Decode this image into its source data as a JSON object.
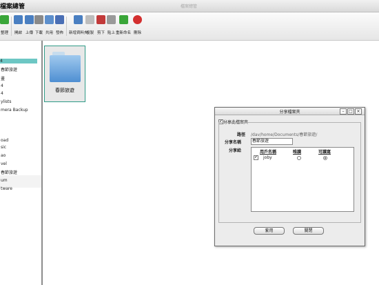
{
  "window": {
    "title": "檔案總管",
    "ghost_title": "檔案總管"
  },
  "toolbar": {
    "buttons": [
      {
        "label": "整理",
        "icon": "refresh-icon",
        "color": "#3aa639"
      },
      {
        "label": "開啟",
        "icon": "open-folder-icon",
        "color": "#4a7fc1"
      },
      {
        "label": "上傳",
        "icon": "upload-icon",
        "color": "#4a7fc1"
      },
      {
        "label": "下載",
        "icon": "download-icon",
        "color": "#8a8a8a"
      },
      {
        "label": "共用",
        "icon": "share-icon",
        "color": "#5d8fcc"
      },
      {
        "label": "發佈",
        "icon": "publish-icon",
        "color": "#4a6fb5"
      },
      {
        "label": "新增資料夾",
        "icon": "new-folder-icon",
        "color": "#4a7fc1"
      },
      {
        "label": "複製",
        "icon": "copy-icon",
        "color": "#bdbdbd"
      },
      {
        "label": "剪下",
        "icon": "cut-icon",
        "color": "#c23a3a"
      },
      {
        "label": "貼上",
        "icon": "paste-icon",
        "color": "#9a9a9a"
      },
      {
        "label": "重新命名",
        "icon": "rename-icon",
        "color": "#3aa639"
      },
      {
        "label": "刪除",
        "icon": "delete-icon",
        "color": "#d32f2f"
      }
    ]
  },
  "sidebar": {
    "items": [
      {
        "label": "4",
        "selected": true
      },
      {
        "label": "春節旅遊",
        "selected": false
      },
      {
        "label": "畫",
        "selected": false
      },
      {
        "label": "4",
        "selected": false
      },
      {
        "label": "4",
        "selected": false
      },
      {
        "label": "ylists",
        "selected": false
      },
      {
        "label": "mera Backup",
        "selected": false
      },
      {
        "label": "oad",
        "selected": false
      },
      {
        "label": "sic",
        "selected": false
      },
      {
        "label": "ao",
        "selected": false
      },
      {
        "label": "vel",
        "selected": false
      },
      {
        "label": "春節旅遊",
        "selected": false
      },
      {
        "label": "um",
        "selected": false
      },
      {
        "label": "tware",
        "selected": false
      }
    ]
  },
  "main": {
    "folder": {
      "name": "春節旅遊"
    }
  },
  "dialog": {
    "title": "分享檔案夾",
    "share_checkbox_label": "分享此檔案夾",
    "share_checked": true,
    "path_label": "路徑",
    "path_value": "/dav/home/Documents/春節旅遊/",
    "share_name_label": "分享名稱",
    "share_name_value": "春節旅遊",
    "share_to_label": "分享給",
    "table": {
      "headers": [
        "用戶名稱",
        "唯讀",
        "可讀寫"
      ],
      "rows": [
        {
          "checked": true,
          "user": "joby",
          "read_only": false,
          "read_write": true
        }
      ]
    },
    "ok_label": "套用",
    "close_label": "關閉"
  }
}
